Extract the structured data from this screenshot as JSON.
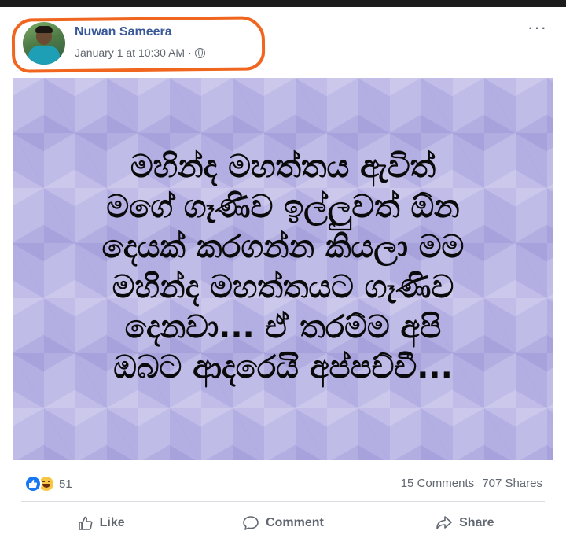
{
  "post": {
    "author_name": "Nuwan Sameera",
    "timestamp": "January 1 at 10:30 AM",
    "separator": "·",
    "privacy_icon": "globe-icon",
    "more_icon": "more-options-icon",
    "more_label": "···"
  },
  "image": {
    "background_color": "#c0bce8",
    "text_lines": [
      "මහින්ද මහත්තය ඇවිත්",
      "මගේ ගෑණිව ඉල්ලුවත් ඕන",
      "දෙයක් කරගන්න කියලා මම",
      "මහින්ද මහත්තයට ගෑණිව",
      "දෙනවා... ඒ තරම්ම අපි",
      "ඔබට ආදරෙයි අප්පච්චී..."
    ]
  },
  "stats": {
    "reaction_icons": [
      "like-reaction-icon",
      "haha-reaction-icon"
    ],
    "reaction_count": "51",
    "comments": "15 Comments",
    "shares": "707 Shares"
  },
  "actions": {
    "like": "Like",
    "comment": "Comment",
    "share": "Share"
  },
  "colors": {
    "author_link": "#385898",
    "meta_text": "#616770",
    "highlight_outline": "#f0661f",
    "like_blue": "#1877f2"
  }
}
